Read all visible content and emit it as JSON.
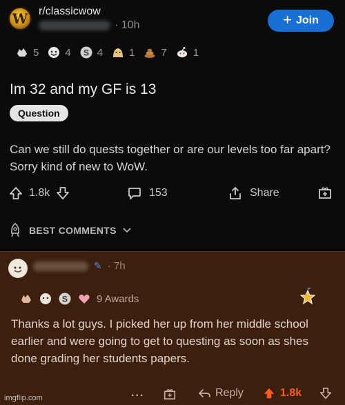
{
  "header": {
    "subreddit": "r/classicwow",
    "time": "· 10h",
    "join_label": "Join",
    "logo_letter": "W"
  },
  "post_awards": [
    {
      "icon": "fist-award-icon",
      "count": "5",
      "color": "#d9d9d9"
    },
    {
      "icon": "wholesome-award-icon",
      "count": "4",
      "color": "#e8e8e8"
    },
    {
      "icon": "silver-award-icon",
      "count": "4",
      "color": "#cfcfcf"
    },
    {
      "icon": "face-award-icon",
      "count": "1",
      "color": "#e7c57a"
    },
    {
      "icon": "poop-award-icon",
      "count": "7",
      "color": "#b5753a"
    },
    {
      "icon": "snoo-award-icon",
      "count": "1",
      "color": "#f0f0f0"
    }
  ],
  "post": {
    "title": "Im 32 and my GF is 13",
    "flair": "Question",
    "body": "Can we still do quests together or are our levels too far apart? Sorry kind of new to WoW."
  },
  "actions": {
    "upvotes": "1.8k",
    "comments": "153",
    "share": "Share"
  },
  "sort": {
    "label": "BEST COMMENTS"
  },
  "comment": {
    "time": "· 7h",
    "awards_label": "9 Awards",
    "body": "Thanks a lot guys. I picked her up from her middle school earlier and were going to get to questing as soon as shes done grading her students papers.",
    "more": "...",
    "reply": "Reply",
    "upvotes": "1.8k"
  },
  "watermark": "imgflip.com",
  "colors": {
    "accent": "#1a6fd4",
    "upvote_active": "#ff5a1f",
    "comment_bg": "#3d1f0e"
  }
}
